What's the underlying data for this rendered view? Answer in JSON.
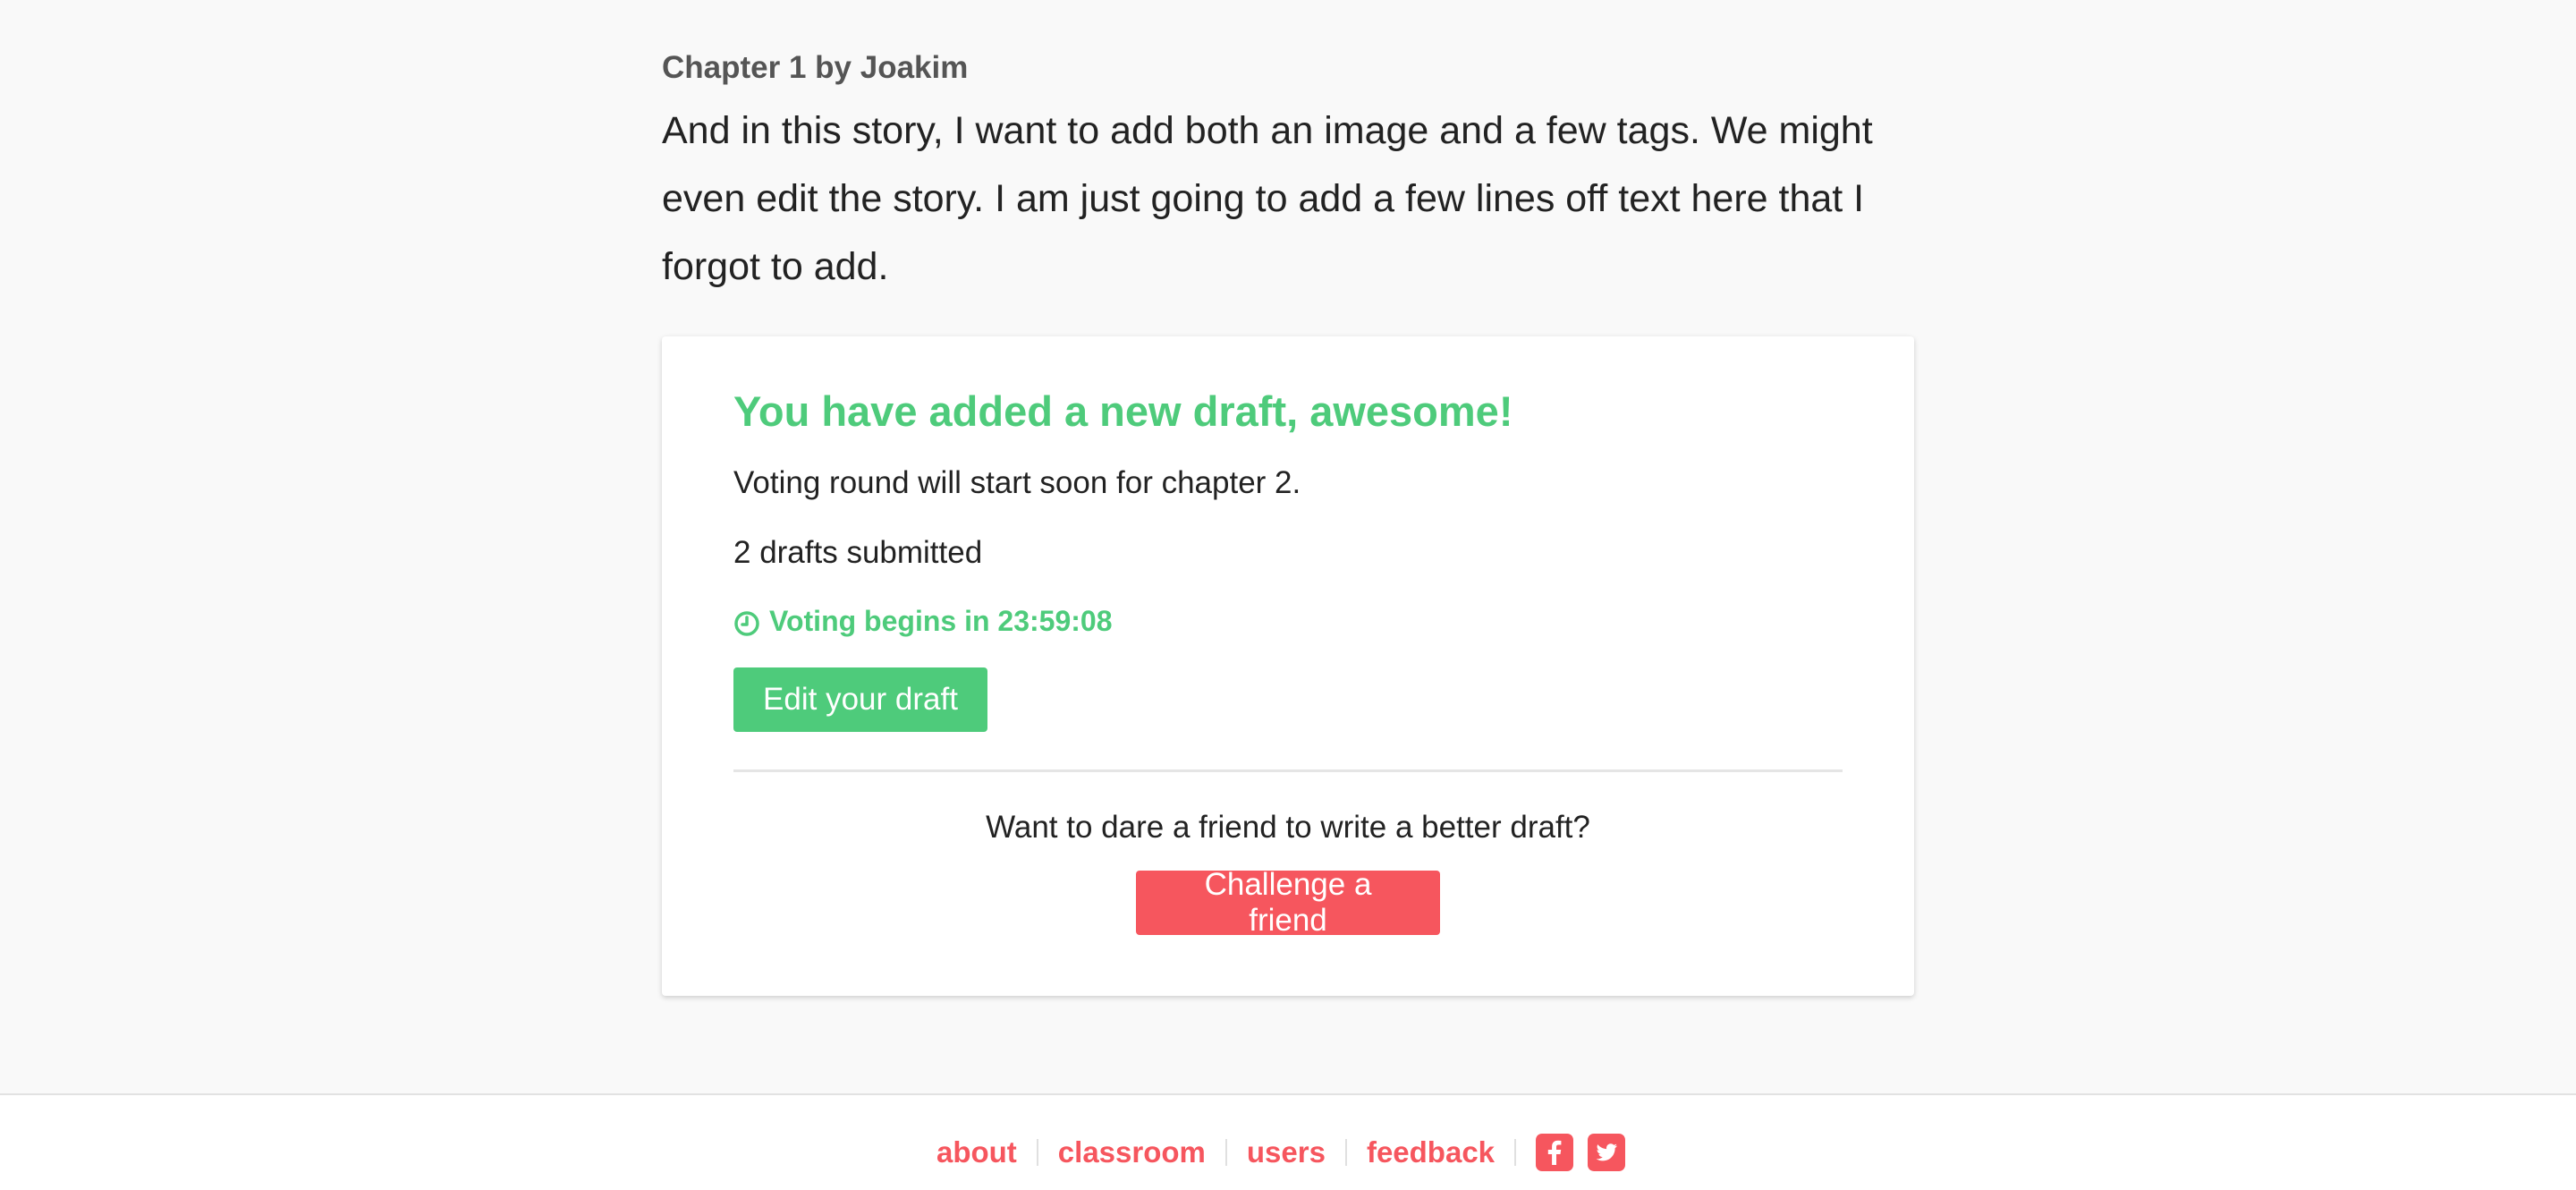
{
  "chapter": {
    "heading": "Chapter 1 by Joakim",
    "text": "And in this story, I want to add both an image and a few tags. We might even edit the story. I am just going to add a few lines off text here that I forgot to add."
  },
  "draft_card": {
    "title": "You have added a new draft, awesome!",
    "voting_status": "Voting round will start soon for chapter 2.",
    "drafts_submitted": "2 drafts submitted",
    "countdown": "Voting begins in 23:59:08",
    "edit_button_label": "Edit your draft",
    "challenge_prompt": "Want to dare a friend to write a better draft?",
    "challenge_button_label": "Challenge a friend"
  },
  "footer": {
    "links": [
      "about",
      "classroom",
      "users",
      "feedback"
    ],
    "social_icons": [
      "facebook-icon",
      "twitter-icon"
    ]
  },
  "colors": {
    "accent_green": "#4ecb7b",
    "accent_red": "#f6565e",
    "page_background": "#f9f9f9"
  }
}
